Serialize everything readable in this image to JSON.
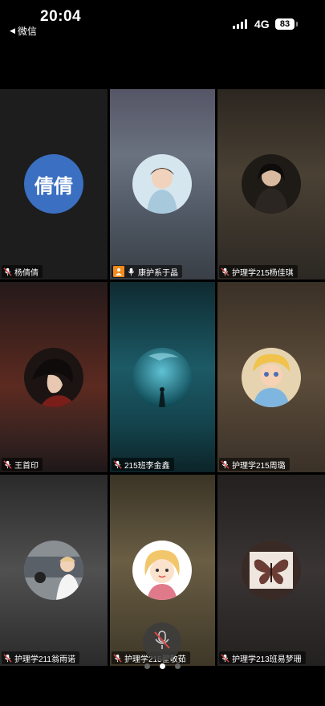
{
  "status_bar": {
    "time": "20:04",
    "back_app": "微信",
    "network": "4G",
    "battery": "83"
  },
  "participants": [
    {
      "name": "杨倩倩",
      "avatar_text": "倩倩",
      "avatar_color": "#3a6fc2",
      "mic": "muted"
    },
    {
      "name": "康护系于晶",
      "mic": "on",
      "is_host": true
    },
    {
      "name": "护理学215杨佳琪",
      "mic": "muted"
    },
    {
      "name": "王首印",
      "mic": "muted"
    },
    {
      "name": "215班李金鑫",
      "mic": "muted"
    },
    {
      "name": "护理学215周璐",
      "mic": "muted"
    },
    {
      "name": "护理学211翁雨诺",
      "mic": "muted"
    },
    {
      "name": "护理学215翟敬茹",
      "mic": "muted"
    },
    {
      "name": "护理学213班易梦珊",
      "mic": "muted"
    }
  ],
  "controls": {
    "mute_button": "mic-muted-icon"
  },
  "pagination": {
    "pages": 3,
    "current": 2
  },
  "colors": {
    "host_badge": "#f38a1a",
    "mute_slash": "#e04848"
  }
}
